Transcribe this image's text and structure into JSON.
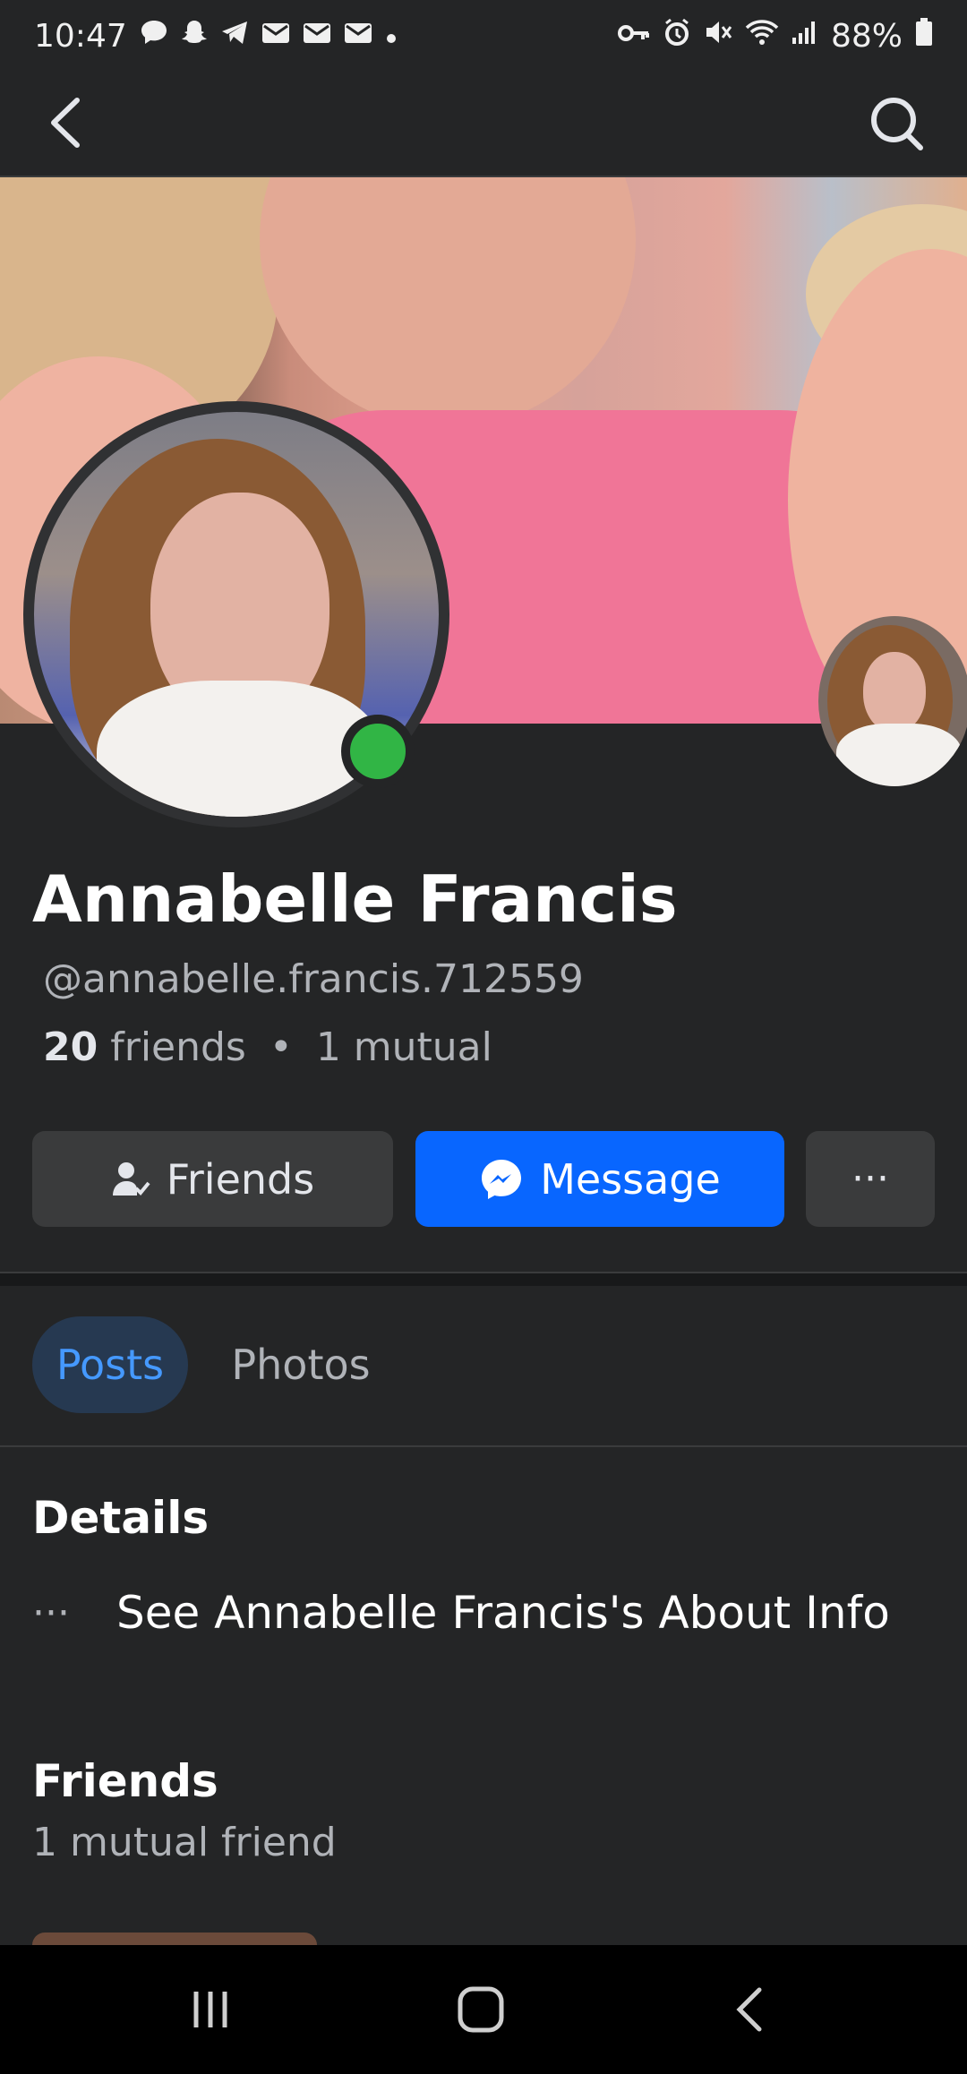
{
  "status_bar": {
    "time": "10:47",
    "battery": "88%",
    "left_icons": [
      "chat-bubble-icon",
      "snapchat-icon",
      "telegram-icon",
      "mail-icon",
      "mail-icon",
      "mail-icon",
      "dot-icon"
    ],
    "right_icons": [
      "key-icon",
      "alarm-icon",
      "mute-icon",
      "wifi-icon",
      "signal-icon",
      "battery-icon"
    ]
  },
  "top_bar": {
    "back_icon": "back-arrow-icon",
    "search_icon": "search-icon"
  },
  "profile": {
    "name": "Annabelle Francis",
    "handle": "@annabelle.francis.712559",
    "friends_count": "20",
    "friends_word": "friends",
    "separator": "•",
    "mutual": "1 mutual",
    "online_color": "#31b545"
  },
  "actions": {
    "friends_label": "Friends",
    "message_label": "Message",
    "more_label": "···",
    "message_color": "#0866ff"
  },
  "tabs": [
    {
      "label": "Posts",
      "active": true
    },
    {
      "label": "Photos",
      "active": false
    }
  ],
  "details": {
    "title": "Details",
    "about_dots": "···",
    "about_label": "See Annabelle Francis's About Info"
  },
  "friends_section": {
    "title": "Friends",
    "subtitle": "1 mutual friend"
  },
  "nav_bar": {
    "icons": [
      "recent-apps-icon",
      "home-icon",
      "back-icon"
    ]
  }
}
